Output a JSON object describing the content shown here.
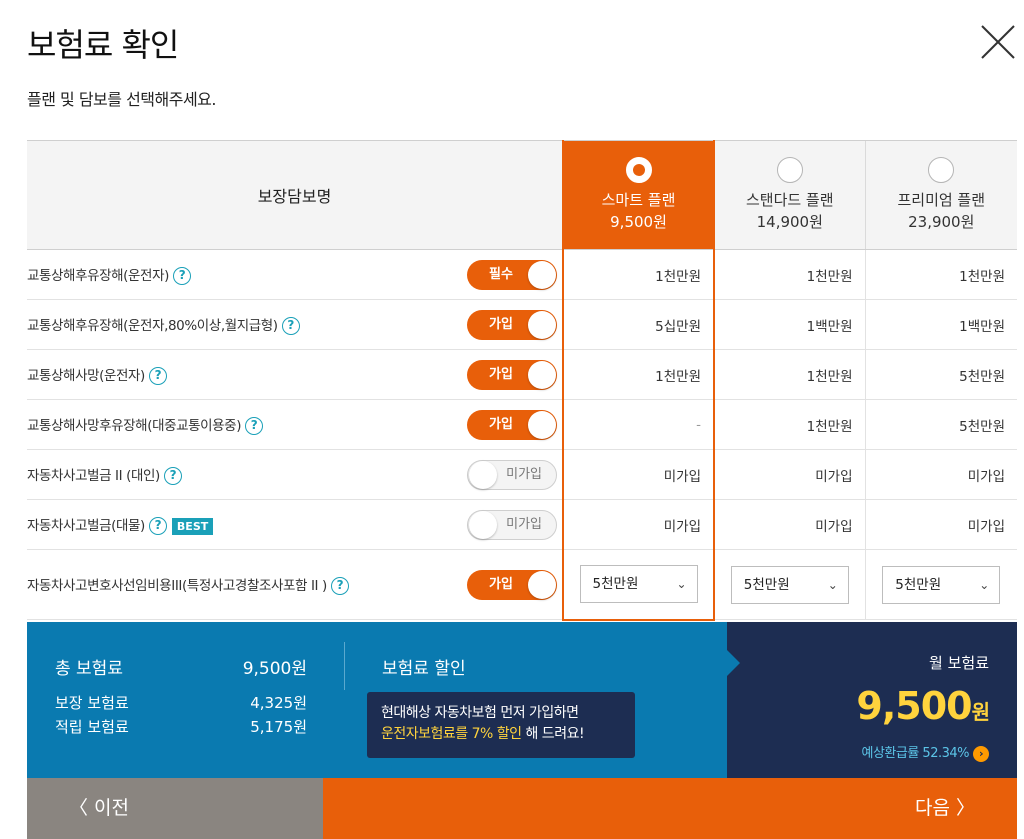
{
  "header": {
    "title": "보험료 확인",
    "subtitle": "플랜 및 담보를 선택해주세요."
  },
  "table": {
    "col_header": "보장담보명",
    "plans": [
      {
        "name": "스마트 플랜",
        "price": "9,500원",
        "selected": true
      },
      {
        "name": "스탠다드 플랜",
        "price": "14,900원",
        "selected": false
      },
      {
        "name": "프리미엄 플랜",
        "price": "23,900원",
        "selected": false
      }
    ],
    "rows": [
      {
        "name": "교통상해후유장해(운전자)",
        "toggle": "필수",
        "values": [
          "1천만원",
          "1천만원",
          "1천만원"
        ]
      },
      {
        "name": "교통상해후유장해(운전자,80%이상,월지급형)",
        "toggle": "가입",
        "values": [
          "5십만원",
          "1백만원",
          "1백만원"
        ]
      },
      {
        "name": "교통상해사망(운전자)",
        "toggle": "가입",
        "values": [
          "1천만원",
          "1천만원",
          "5천만원"
        ]
      },
      {
        "name": "교통상해사망후유장해(대중교통이용중)",
        "toggle": "가입",
        "values": [
          "-",
          "1천만원",
          "5천만원"
        ]
      },
      {
        "name": "자동차사고벌금 II (대인)",
        "toggle": "미가입",
        "values": [
          "미가입",
          "미가입",
          "미가입"
        ]
      },
      {
        "name": "자동차사고벌금(대물)",
        "badge": "BEST",
        "toggle": "미가입",
        "values": [
          "미가입",
          "미가입",
          "미가입"
        ]
      },
      {
        "name": "자동차사고변호사선임비용III(특정사고경찰조사포함 II )",
        "toggle": "가입",
        "values": [
          "5천만원",
          "5천만원",
          "5천만원"
        ]
      }
    ]
  },
  "summary": {
    "total_label": "총 보험료",
    "total_value": "9,500원",
    "coverage_label": "보장 보험료",
    "coverage_value": "4,325원",
    "savings_label": "적립 보험료",
    "savings_value": "5,175원",
    "discount_title": "보험료 할인",
    "banner_line1": "현대해상 자동차보험 먼저 가입하면",
    "banner_hl": "운전자보험료를 7% 할인",
    "banner_tail": " 해 드려요!",
    "monthly_label": "월 보험료",
    "monthly_amount": "9,500",
    "monthly_unit": "원",
    "refund_text": "예상환급률 52.34%"
  },
  "nav": {
    "prev_label": "〈  이전",
    "next_label": "다음  〉"
  },
  "colors": {
    "accent": "#e85f0a",
    "blue": "#0a7ab0",
    "navy": "#1d2d52",
    "yellow": "#ffd33d",
    "teal": "#1aa0b8"
  }
}
